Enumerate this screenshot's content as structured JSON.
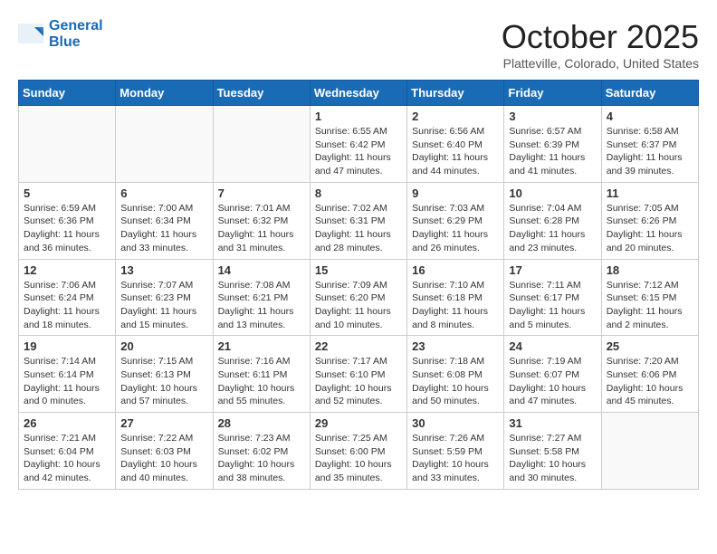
{
  "header": {
    "logo_line1": "General",
    "logo_line2": "Blue",
    "month": "October 2025",
    "location": "Platteville, Colorado, United States"
  },
  "days_of_week": [
    "Sunday",
    "Monday",
    "Tuesday",
    "Wednesday",
    "Thursday",
    "Friday",
    "Saturday"
  ],
  "weeks": [
    [
      {
        "day": "",
        "info": ""
      },
      {
        "day": "",
        "info": ""
      },
      {
        "day": "",
        "info": ""
      },
      {
        "day": "1",
        "info": "Sunrise: 6:55 AM\nSunset: 6:42 PM\nDaylight: 11 hours\nand 47 minutes."
      },
      {
        "day": "2",
        "info": "Sunrise: 6:56 AM\nSunset: 6:40 PM\nDaylight: 11 hours\nand 44 minutes."
      },
      {
        "day": "3",
        "info": "Sunrise: 6:57 AM\nSunset: 6:39 PM\nDaylight: 11 hours\nand 41 minutes."
      },
      {
        "day": "4",
        "info": "Sunrise: 6:58 AM\nSunset: 6:37 PM\nDaylight: 11 hours\nand 39 minutes."
      }
    ],
    [
      {
        "day": "5",
        "info": "Sunrise: 6:59 AM\nSunset: 6:36 PM\nDaylight: 11 hours\nand 36 minutes."
      },
      {
        "day": "6",
        "info": "Sunrise: 7:00 AM\nSunset: 6:34 PM\nDaylight: 11 hours\nand 33 minutes."
      },
      {
        "day": "7",
        "info": "Sunrise: 7:01 AM\nSunset: 6:32 PM\nDaylight: 11 hours\nand 31 minutes."
      },
      {
        "day": "8",
        "info": "Sunrise: 7:02 AM\nSunset: 6:31 PM\nDaylight: 11 hours\nand 28 minutes."
      },
      {
        "day": "9",
        "info": "Sunrise: 7:03 AM\nSunset: 6:29 PM\nDaylight: 11 hours\nand 26 minutes."
      },
      {
        "day": "10",
        "info": "Sunrise: 7:04 AM\nSunset: 6:28 PM\nDaylight: 11 hours\nand 23 minutes."
      },
      {
        "day": "11",
        "info": "Sunrise: 7:05 AM\nSunset: 6:26 PM\nDaylight: 11 hours\nand 20 minutes."
      }
    ],
    [
      {
        "day": "12",
        "info": "Sunrise: 7:06 AM\nSunset: 6:24 PM\nDaylight: 11 hours\nand 18 minutes."
      },
      {
        "day": "13",
        "info": "Sunrise: 7:07 AM\nSunset: 6:23 PM\nDaylight: 11 hours\nand 15 minutes."
      },
      {
        "day": "14",
        "info": "Sunrise: 7:08 AM\nSunset: 6:21 PM\nDaylight: 11 hours\nand 13 minutes."
      },
      {
        "day": "15",
        "info": "Sunrise: 7:09 AM\nSunset: 6:20 PM\nDaylight: 11 hours\nand 10 minutes."
      },
      {
        "day": "16",
        "info": "Sunrise: 7:10 AM\nSunset: 6:18 PM\nDaylight: 11 hours\nand 8 minutes."
      },
      {
        "day": "17",
        "info": "Sunrise: 7:11 AM\nSunset: 6:17 PM\nDaylight: 11 hours\nand 5 minutes."
      },
      {
        "day": "18",
        "info": "Sunrise: 7:12 AM\nSunset: 6:15 PM\nDaylight: 11 hours\nand 2 minutes."
      }
    ],
    [
      {
        "day": "19",
        "info": "Sunrise: 7:14 AM\nSunset: 6:14 PM\nDaylight: 11 hours\nand 0 minutes."
      },
      {
        "day": "20",
        "info": "Sunrise: 7:15 AM\nSunset: 6:13 PM\nDaylight: 10 hours\nand 57 minutes."
      },
      {
        "day": "21",
        "info": "Sunrise: 7:16 AM\nSunset: 6:11 PM\nDaylight: 10 hours\nand 55 minutes."
      },
      {
        "day": "22",
        "info": "Sunrise: 7:17 AM\nSunset: 6:10 PM\nDaylight: 10 hours\nand 52 minutes."
      },
      {
        "day": "23",
        "info": "Sunrise: 7:18 AM\nSunset: 6:08 PM\nDaylight: 10 hours\nand 50 minutes."
      },
      {
        "day": "24",
        "info": "Sunrise: 7:19 AM\nSunset: 6:07 PM\nDaylight: 10 hours\nand 47 minutes."
      },
      {
        "day": "25",
        "info": "Sunrise: 7:20 AM\nSunset: 6:06 PM\nDaylight: 10 hours\nand 45 minutes."
      }
    ],
    [
      {
        "day": "26",
        "info": "Sunrise: 7:21 AM\nSunset: 6:04 PM\nDaylight: 10 hours\nand 42 minutes."
      },
      {
        "day": "27",
        "info": "Sunrise: 7:22 AM\nSunset: 6:03 PM\nDaylight: 10 hours\nand 40 minutes."
      },
      {
        "day": "28",
        "info": "Sunrise: 7:23 AM\nSunset: 6:02 PM\nDaylight: 10 hours\nand 38 minutes."
      },
      {
        "day": "29",
        "info": "Sunrise: 7:25 AM\nSunset: 6:00 PM\nDaylight: 10 hours\nand 35 minutes."
      },
      {
        "day": "30",
        "info": "Sunrise: 7:26 AM\nSunset: 5:59 PM\nDaylight: 10 hours\nand 33 minutes."
      },
      {
        "day": "31",
        "info": "Sunrise: 7:27 AM\nSunset: 5:58 PM\nDaylight: 10 hours\nand 30 minutes."
      },
      {
        "day": "",
        "info": ""
      }
    ]
  ]
}
